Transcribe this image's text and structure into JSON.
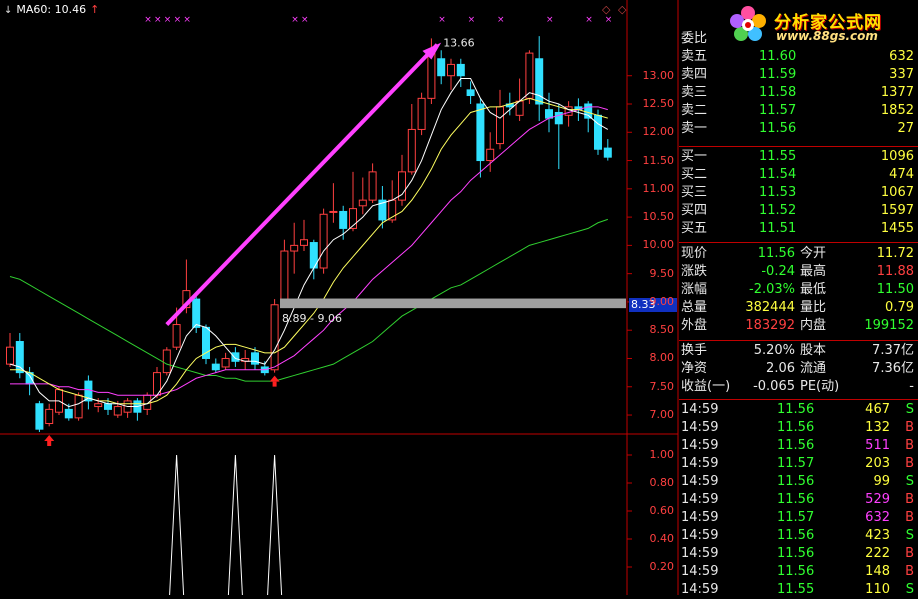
{
  "indicator": {
    "label": "MA60: 10.46"
  },
  "annotations": {
    "peak_label": "13.66",
    "gap_label": "8.89 - 9.06"
  },
  "current_price_box": "8.33",
  "logo": {
    "title": "分析家公式网",
    "url": "www.88gs.com"
  },
  "price_axis": [
    "13.00",
    "12.50",
    "12.00",
    "11.50",
    "11.00",
    "10.50",
    "10.00",
    "9.50",
    "9.00",
    "8.50",
    "8.00",
    "7.50",
    "7.00"
  ],
  "sub_axis": [
    "1.00",
    "0.80",
    "0.60",
    "0.40",
    "0.20"
  ],
  "order_book": {
    "header": "委比",
    "asks": [
      {
        "label": "卖五",
        "price": "11.60",
        "vol": "632"
      },
      {
        "label": "卖四",
        "price": "11.59",
        "vol": "337"
      },
      {
        "label": "卖三",
        "price": "11.58",
        "vol": "1377"
      },
      {
        "label": "卖二",
        "price": "11.57",
        "vol": "1852"
      },
      {
        "label": "卖一",
        "price": "11.56",
        "vol": "27"
      }
    ],
    "bids": [
      {
        "label": "买一",
        "price": "11.55",
        "vol": "1096"
      },
      {
        "label": "买二",
        "price": "11.54",
        "vol": "474"
      },
      {
        "label": "买三",
        "price": "11.53",
        "vol": "1067"
      },
      {
        "label": "买四",
        "price": "11.52",
        "vol": "1597"
      },
      {
        "label": "买五",
        "price": "11.51",
        "vol": "1455"
      }
    ]
  },
  "quote": [
    {
      "k1": "现价",
      "v1": "11.56",
      "c1": "green",
      "k2": "今开",
      "v2": "11.72",
      "c2": "yellow"
    },
    {
      "k1": "涨跌",
      "v1": "-0.24",
      "c1": "green",
      "k2": "最高",
      "v2": "11.88",
      "c2": "red"
    },
    {
      "k1": "涨幅",
      "v1": "-2.03%",
      "c1": "green",
      "k2": "最低",
      "v2": "11.50",
      "c2": "green"
    },
    {
      "k1": "总量",
      "v1": "382444",
      "c1": "yellow",
      "k2": "量比",
      "v2": "0.79",
      "c2": "yellow"
    },
    {
      "k1": "外盘",
      "v1": "183292",
      "c1": "red",
      "k2": "内盘",
      "v2": "199152",
      "c2": "green"
    }
  ],
  "fundamentals": [
    {
      "k1": "换手",
      "v1": "5.20%",
      "k2": "股本",
      "v2": "7.37亿"
    },
    {
      "k1": "净资",
      "v1": "2.06",
      "k2": "流通",
      "v2": "7.36亿"
    },
    {
      "k1": "收益(一)",
      "v1": "-0.065",
      "k2": "PE(动)",
      "v2": "-"
    }
  ],
  "ticks": [
    {
      "time": "14:59",
      "price": "11.56",
      "vol": "467",
      "vc": "yellow",
      "side": "S"
    },
    {
      "time": "14:59",
      "price": "11.56",
      "vol": "132",
      "vc": "yellow",
      "side": "B"
    },
    {
      "time": "14:59",
      "price": "11.56",
      "vol": "511",
      "vc": "magenta",
      "side": "B"
    },
    {
      "time": "14:59",
      "price": "11.57",
      "vol": "203",
      "vc": "yellow",
      "side": "B"
    },
    {
      "time": "14:59",
      "price": "11.56",
      "vol": "99",
      "vc": "yellow",
      "side": "S"
    },
    {
      "time": "14:59",
      "price": "11.56",
      "vol": "529",
      "vc": "magenta",
      "side": "B"
    },
    {
      "time": "14:59",
      "price": "11.57",
      "vol": "632",
      "vc": "magenta",
      "side": "B"
    },
    {
      "time": "14:59",
      "price": "11.56",
      "vol": "423",
      "vc": "yellow",
      "side": "S"
    },
    {
      "time": "14:59",
      "price": "11.56",
      "vol": "222",
      "vc": "yellow",
      "side": "B"
    },
    {
      "time": "14:59",
      "price": "11.56",
      "vol": "148",
      "vc": "yellow",
      "side": "B"
    },
    {
      "time": "14:59",
      "price": "11.55",
      "vol": "110",
      "vc": "yellow",
      "side": "S"
    }
  ],
  "colors": {
    "up": "#ff4040",
    "down": "#30e0ff",
    "ma5": "#ffffff",
    "ma10": "#ffff60",
    "ma20": "#ff40ff",
    "ma60": "#30d030",
    "axis": "#c00000"
  },
  "chart_data": {
    "type": "candlestick",
    "price_ylim": [
      6.7,
      13.95
    ],
    "candles": [
      [
        7.9,
        8.2,
        8.45,
        7.85
      ],
      [
        8.3,
        7.75,
        8.45,
        7.65
      ],
      [
        7.75,
        7.55,
        7.85,
        7.35
      ],
      [
        7.2,
        6.75,
        7.25,
        6.7
      ],
      [
        6.85,
        7.1,
        7.2,
        6.8
      ],
      [
        7.05,
        7.45,
        7.5,
        7.0
      ],
      [
        7.1,
        6.95,
        7.2,
        6.9
      ],
      [
        6.95,
        7.35,
        7.4,
        6.9
      ],
      [
        7.6,
        7.25,
        7.7,
        7.1
      ],
      [
        7.15,
        7.2,
        7.3,
        7.05
      ],
      [
        7.2,
        7.1,
        7.3,
        7.0
      ],
      [
        7.0,
        7.15,
        7.25,
        6.95
      ],
      [
        7.05,
        7.25,
        7.3,
        6.95
      ],
      [
        7.25,
        7.05,
        7.3,
        6.9
      ],
      [
        7.1,
        7.35,
        7.4,
        7.0
      ],
      [
        7.35,
        7.75,
        7.85,
        7.3
      ],
      [
        7.75,
        8.15,
        8.2,
        7.7
      ],
      [
        8.2,
        8.6,
        8.9,
        8.15
      ],
      [
        8.9,
        9.2,
        9.75,
        8.8
      ],
      [
        9.05,
        8.55,
        9.15,
        8.45
      ],
      [
        8.55,
        8.0,
        8.6,
        7.9
      ],
      [
        7.9,
        7.8,
        8.0,
        7.75
      ],
      [
        7.85,
        8.0,
        8.1,
        7.8
      ],
      [
        8.1,
        7.95,
        8.2,
        7.85
      ],
      [
        7.95,
        8.0,
        8.15,
        7.8
      ],
      [
        8.1,
        7.9,
        8.2,
        7.8
      ],
      [
        7.85,
        7.75,
        7.95,
        7.7
      ],
      [
        7.8,
        8.95,
        9.05,
        7.75
      ],
      [
        8.95,
        9.9,
        10.1,
        8.9
      ],
      [
        9.9,
        10.0,
        10.4,
        9.5
      ],
      [
        10.0,
        10.1,
        10.45,
        9.9
      ],
      [
        10.05,
        9.6,
        10.1,
        9.4
      ],
      [
        9.6,
        10.55,
        10.65,
        9.5
      ],
      [
        10.6,
        10.6,
        11.1,
        10.4
      ],
      [
        10.6,
        10.3,
        10.7,
        10.1
      ],
      [
        10.3,
        10.65,
        11.3,
        10.25
      ],
      [
        10.7,
        10.8,
        11.2,
        10.55
      ],
      [
        10.8,
        11.3,
        11.45,
        10.75
      ],
      [
        10.8,
        10.45,
        11.05,
        10.3
      ],
      [
        10.45,
        10.8,
        11.15,
        10.4
      ],
      [
        10.8,
        11.3,
        11.6,
        10.7
      ],
      [
        11.3,
        12.05,
        12.5,
        11.25
      ],
      [
        12.05,
        12.6,
        12.7,
        11.95
      ],
      [
        12.6,
        13.45,
        13.66,
        12.5
      ],
      [
        13.3,
        13.0,
        13.45,
        12.85
      ],
      [
        13.0,
        13.2,
        13.3,
        12.75
      ],
      [
        13.2,
        13.0,
        13.3,
        12.8
      ],
      [
        12.75,
        12.65,
        12.9,
        12.5
      ],
      [
        12.5,
        11.5,
        12.6,
        11.2
      ],
      [
        11.5,
        11.7,
        12.0,
        11.3
      ],
      [
        11.8,
        12.45,
        12.75,
        11.7
      ],
      [
        12.5,
        12.45,
        12.7,
        12.3
      ],
      [
        12.3,
        12.55,
        12.95,
        12.2
      ],
      [
        12.6,
        13.4,
        13.45,
        12.5
      ],
      [
        13.3,
        12.5,
        13.7,
        12.2
      ],
      [
        12.4,
        12.25,
        12.7,
        12.0
      ],
      [
        12.35,
        12.15,
        12.5,
        11.35
      ],
      [
        12.3,
        12.45,
        12.55,
        12.1
      ],
      [
        12.45,
        12.4,
        12.6,
        12.2
      ],
      [
        12.5,
        12.25,
        12.55,
        12.0
      ],
      [
        12.3,
        11.7,
        12.4,
        11.6
      ],
      [
        11.72,
        11.56,
        11.88,
        11.5
      ]
    ],
    "ma5": [
      7.9,
      7.85,
      7.7,
      7.4,
      7.25,
      7.25,
      7.15,
      7.2,
      7.3,
      7.25,
      7.2,
      7.2,
      7.15,
      7.15,
      7.2,
      7.35,
      7.6,
      8.0,
      8.4,
      8.6,
      8.55,
      8.4,
      8.2,
      8.0,
      7.95,
      7.95,
      7.9,
      8.15,
      8.5,
      8.9,
      9.3,
      9.6,
      9.9,
      10.1,
      10.2,
      10.35,
      10.5,
      10.7,
      10.75,
      10.8,
      10.9,
      11.15,
      11.5,
      11.95,
      12.4,
      12.7,
      12.95,
      12.95,
      12.6,
      12.35,
      12.25,
      12.4,
      12.55,
      12.7,
      12.65,
      12.55,
      12.5,
      12.4,
      12.35,
      12.3,
      12.15,
      12.05
    ],
    "ma10": [
      7.8,
      7.8,
      7.75,
      7.65,
      7.55,
      7.45,
      7.4,
      7.35,
      7.3,
      7.25,
      7.25,
      7.2,
      7.2,
      7.2,
      7.2,
      7.25,
      7.35,
      7.55,
      7.8,
      8.0,
      8.1,
      8.2,
      8.25,
      8.25,
      8.2,
      8.15,
      8.1,
      8.1,
      8.2,
      8.4,
      8.6,
      8.8,
      9.05,
      9.35,
      9.6,
      9.8,
      10.0,
      10.2,
      10.4,
      10.5,
      10.6,
      10.8,
      11.05,
      11.35,
      11.7,
      11.95,
      12.15,
      12.35,
      12.4,
      12.45,
      12.45,
      12.5,
      12.55,
      12.6,
      12.55,
      12.5,
      12.45,
      12.4,
      12.4,
      12.35,
      12.3,
      12.25
    ],
    "ma20": [
      7.55,
      7.55,
      7.55,
      7.55,
      7.55,
      7.5,
      7.5,
      7.45,
      7.45,
      7.4,
      7.4,
      7.35,
      7.35,
      7.35,
      7.35,
      7.35,
      7.4,
      7.45,
      7.55,
      7.65,
      7.7,
      7.75,
      7.8,
      7.8,
      7.8,
      7.8,
      7.8,
      7.85,
      7.95,
      8.05,
      8.2,
      8.35,
      8.5,
      8.7,
      8.85,
      9.0,
      9.2,
      9.4,
      9.55,
      9.7,
      9.85,
      10.0,
      10.2,
      10.4,
      10.6,
      10.8,
      10.95,
      11.15,
      11.3,
      11.45,
      11.6,
      11.75,
      11.9,
      12.05,
      12.15,
      12.25,
      12.3,
      12.35,
      12.4,
      12.45,
      12.45,
      12.4
    ],
    "ma60": [
      9.45,
      9.4,
      9.3,
      9.2,
      9.1,
      9.0,
      8.9,
      8.8,
      8.7,
      8.6,
      8.5,
      8.4,
      8.3,
      8.2,
      8.1,
      8.0,
      7.9,
      7.85,
      7.8,
      7.75,
      7.7,
      7.7,
      7.65,
      7.65,
      7.6,
      7.6,
      7.6,
      7.6,
      7.65,
      7.7,
      7.75,
      7.8,
      7.85,
      7.9,
      8.0,
      8.1,
      8.2,
      8.3,
      8.45,
      8.6,
      8.75,
      8.85,
      8.95,
      9.05,
      9.15,
      9.25,
      9.3,
      9.4,
      9.5,
      9.6,
      9.7,
      9.8,
      9.9,
      10.0,
      10.05,
      10.1,
      10.15,
      10.2,
      10.25,
      10.3,
      10.4,
      10.46
    ],
    "gap_band": [
      8.89,
      9.06
    ],
    "signal_peaks": [
      17,
      23,
      27
    ],
    "signal_ylim": [
      0,
      1.0
    ]
  }
}
